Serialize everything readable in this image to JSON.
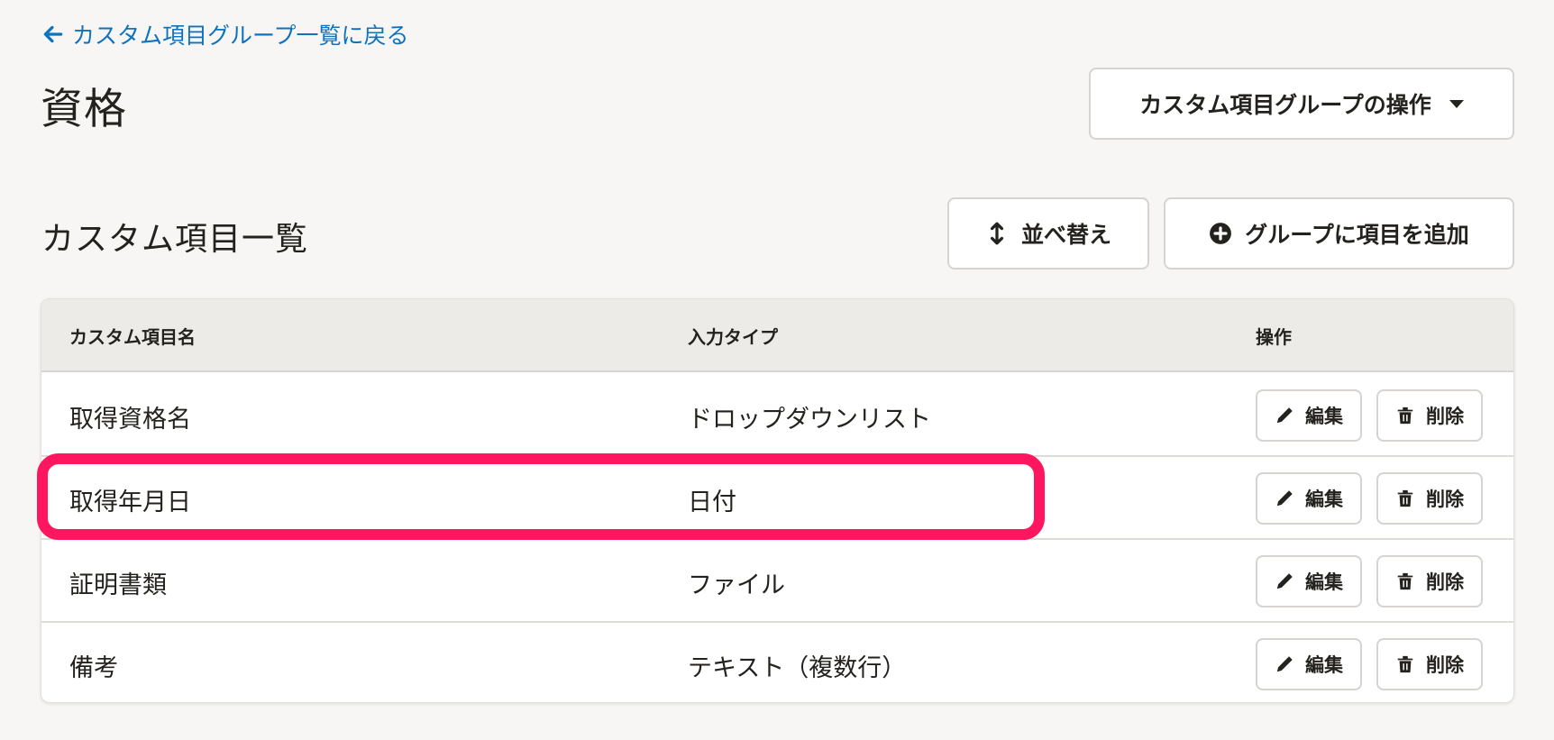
{
  "back_link": {
    "label": "カスタム項目グループ一覧に戻る",
    "icon": "arrow-left-icon"
  },
  "page_title": "資格",
  "group_ops_button": {
    "label": "カスタム項目グループの操作",
    "icon": "caret-down-icon"
  },
  "section_title": "カスタム項目一覧",
  "sort_button": {
    "label": "並べ替え",
    "icon": "vertical-arrows-icon"
  },
  "add_button": {
    "label": "グループに項目を追加",
    "icon": "plus-circle-icon"
  },
  "table": {
    "headers": {
      "name": "カスタム項目名",
      "type": "入力タイプ",
      "actions": "操作"
    },
    "rows": [
      {
        "name": "取得資格名",
        "type": "ドロップダウンリスト",
        "edit_label": "編集",
        "delete_label": "削除"
      },
      {
        "name": "取得年月日",
        "type": "日付",
        "edit_label": "編集",
        "delete_label": "削除"
      },
      {
        "name": "証明書類",
        "type": "ファイル",
        "edit_label": "編集",
        "delete_label": "削除"
      },
      {
        "name": "備考",
        "type": "テキスト（複数行）",
        "edit_label": "編集",
        "delete_label": "削除"
      }
    ]
  },
  "colors": {
    "link": "#0f72bd",
    "highlight": "#fe1661",
    "background": "#f7f6f4",
    "header_background": "#edebe8"
  }
}
